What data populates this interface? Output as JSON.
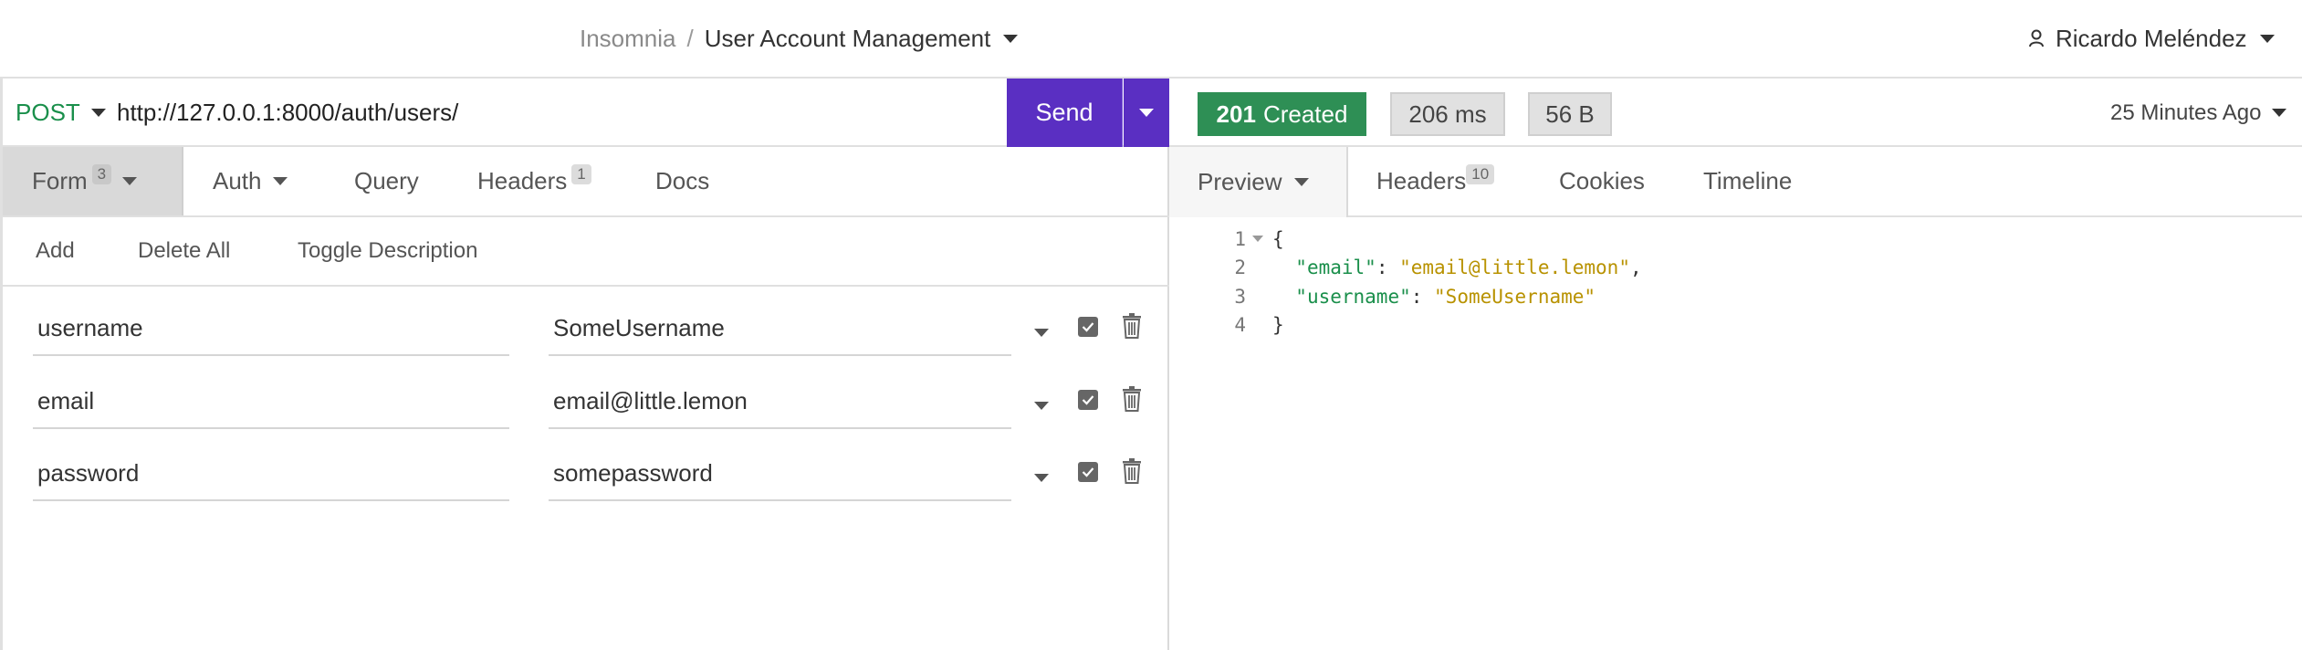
{
  "header": {
    "workspace": "Insomnia",
    "separator": "/",
    "collection": "User Account Management",
    "user": "Ricardo Meléndez"
  },
  "request": {
    "method": "POST",
    "url": "http://127.0.0.1:8000/auth/users/",
    "send_label": "Send",
    "tabs": [
      {
        "label": "Form",
        "badge": "3"
      },
      {
        "label": "Auth"
      },
      {
        "label": "Query"
      },
      {
        "label": "Headers",
        "badge": "1"
      },
      {
        "label": "Docs"
      }
    ],
    "toolbar": {
      "add": "Add",
      "delete_all": "Delete All",
      "toggle_description": "Toggle Description"
    },
    "params": [
      {
        "name": "username",
        "value": "SomeUsername",
        "enabled": true
      },
      {
        "name": "email",
        "value": "email@little.lemon",
        "enabled": true
      },
      {
        "name": "password",
        "value": "somepassword",
        "enabled": true
      }
    ]
  },
  "response": {
    "status_code": "201",
    "status_text": "Created",
    "time": "206 ms",
    "size": "56 B",
    "when": "25 Minutes Ago",
    "tabs": [
      {
        "label": "Preview"
      },
      {
        "label": "Headers",
        "badge": "10"
      },
      {
        "label": "Cookies"
      },
      {
        "label": "Timeline"
      }
    ],
    "body_lines": [
      {
        "n": "1",
        "open": "{"
      },
      {
        "n": "2",
        "key": "\"email\"",
        "colon": ": ",
        "value": "\"email@little.lemon\"",
        "comma": ","
      },
      {
        "n": "3",
        "key": "\"username\"",
        "colon": ": ",
        "value": "\"SomeUsername\"",
        "comma": ""
      },
      {
        "n": "4",
        "close": "}"
      }
    ]
  },
  "colors": {
    "send_button": "#5a2fc2",
    "status_success": "#2e8f55",
    "method_post": "#1a8f4b",
    "json_key": "#1a8f4b",
    "json_string": "#b89200"
  }
}
